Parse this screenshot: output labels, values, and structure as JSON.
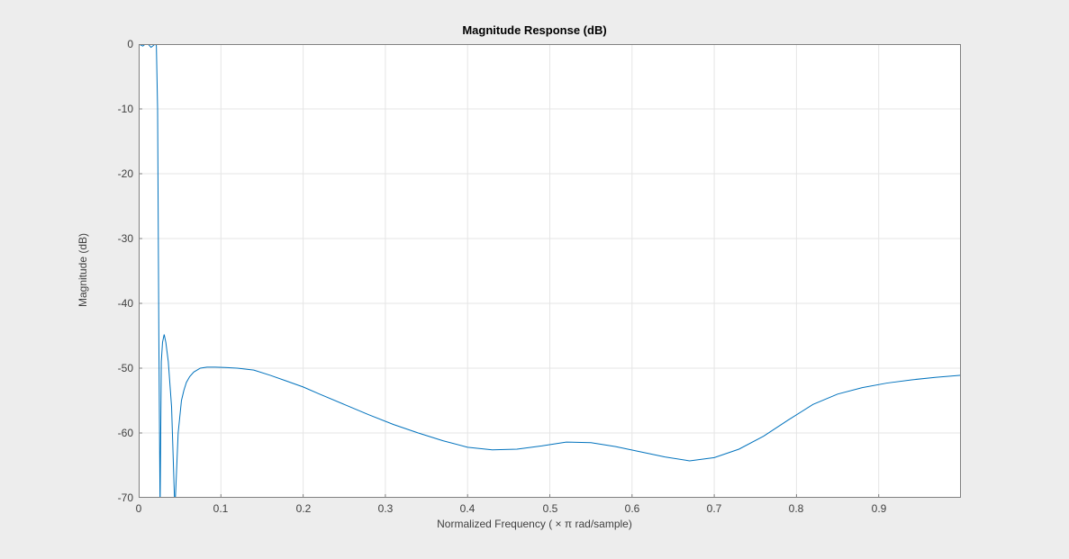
{
  "chart_data": {
    "type": "line",
    "title": "Magnitude Response (dB)",
    "xlabel": "Normalized  Frequency  ( × π  rad/sample)",
    "ylabel": "Magnitude (dB)",
    "xlim": [
      0,
      1
    ],
    "ylim": [
      -70,
      0
    ],
    "xticks": [
      0,
      0.1,
      0.2,
      0.3,
      0.4,
      0.5,
      0.6,
      0.7,
      0.8,
      0.9
    ],
    "yticks": [
      0,
      -10,
      -20,
      -30,
      -40,
      -50,
      -60,
      -70
    ],
    "series": [
      {
        "name": "Magnitude",
        "color": "#0072bd",
        "x": [
          0,
          0.005,
          0.01,
          0.015,
          0.02,
          0.0215,
          0.023,
          0.0245,
          0.026,
          0.0275,
          0.029,
          0.031,
          0.033,
          0.036,
          0.04,
          0.044,
          0.048,
          0.052,
          0.055,
          0.058,
          0.062,
          0.067,
          0.075,
          0.083,
          0.093,
          0.105,
          0.12,
          0.14,
          0.16,
          0.18,
          0.2,
          0.22,
          0.25,
          0.28,
          0.31,
          0.34,
          0.37,
          0.4,
          0.43,
          0.46,
          0.49,
          0.52,
          0.55,
          0.58,
          0.61,
          0.64,
          0.67,
          0.7,
          0.73,
          0.76,
          0.79,
          0.82,
          0.85,
          0.88,
          0.91,
          0.94,
          0.97,
          0.99,
          1
        ],
        "y": [
          0,
          -0.3,
          0.2,
          -0.5,
          0,
          -0.2,
          -10,
          -45,
          -72,
          -49,
          -46,
          -44.8,
          -46,
          -49,
          -56,
          -72,
          -60,
          -55,
          -53.4,
          -52.2,
          -51.3,
          -50.6,
          -50,
          -49.85,
          -49.85,
          -49.9,
          -50,
          -50.3,
          -51.1,
          -52,
          -52.9,
          -54,
          -55.6,
          -57.2,
          -58.7,
          -60,
          -61.2,
          -62.2,
          -62.6,
          -62.5,
          -62,
          -61.4,
          -61.5,
          -62.1,
          -62.9,
          -63.7,
          -64.3,
          -63.8,
          -62.5,
          -60.5,
          -58,
          -55.6,
          -54,
          -53,
          -52.3,
          -51.8,
          -51.4,
          -51.2,
          -51.1
        ]
      }
    ]
  },
  "ticks": {
    "x": [
      "0",
      "0.1",
      "0.2",
      "0.3",
      "0.4",
      "0.5",
      "0.6",
      "0.7",
      "0.8",
      "0.9"
    ],
    "y": [
      "0",
      "-10",
      "-20",
      "-30",
      "-40",
      "-50",
      "-60",
      "-70"
    ]
  }
}
